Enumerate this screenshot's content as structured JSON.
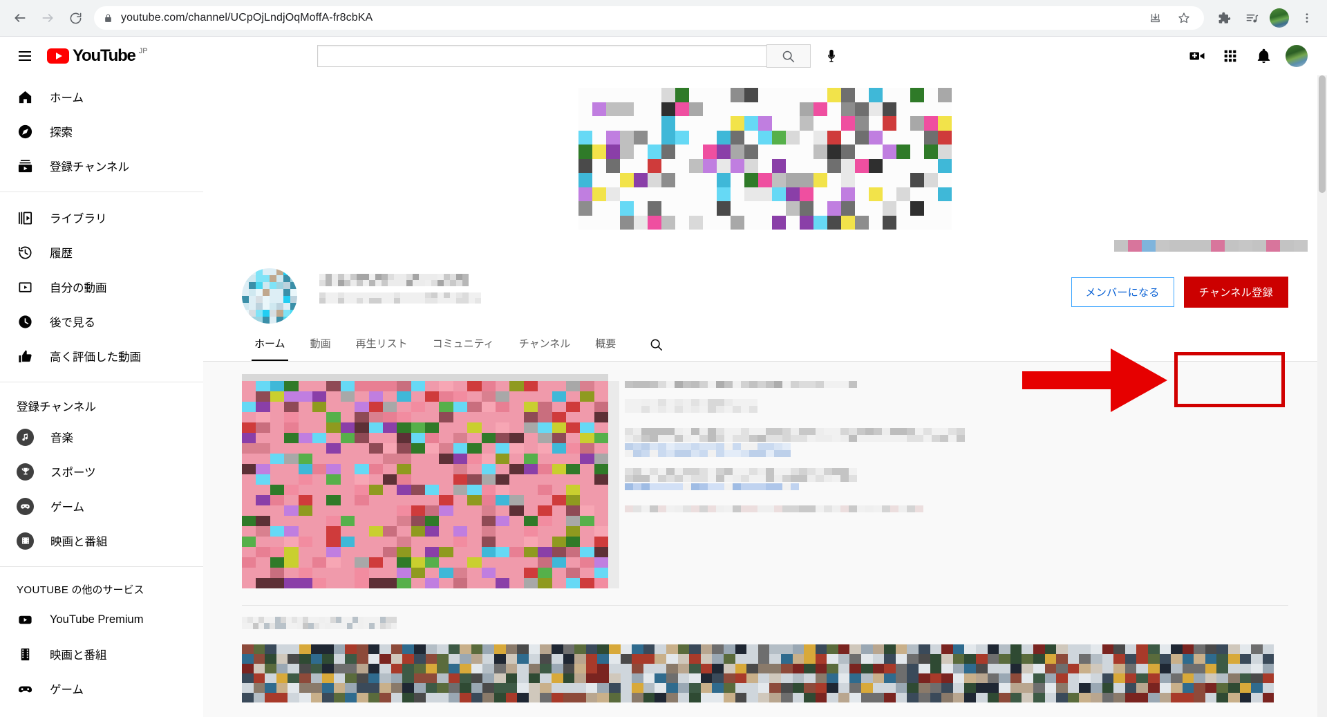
{
  "browser": {
    "back_icon": "back-arrow-icon",
    "forward_icon": "forward-arrow-icon",
    "reload_icon": "reload-icon",
    "lock_icon": "lock-icon",
    "url": "youtube.com/channel/UCpOjLndjOqMoffA-fr8cbKA",
    "url_domain": "youtube.com",
    "url_path": "/channel/UCpOjLndjOqMoffA-fr8cbKA",
    "install_icon": "install-app-icon",
    "bookmark_icon": "star-icon",
    "extensions_icon": "puzzle-piece-icon",
    "media_icon": "music-queue-icon",
    "profile_icon": "profile-avatar",
    "menu_icon": "three-dot-menu-icon"
  },
  "masthead": {
    "menu_icon": "hamburger-menu-icon",
    "logo_text": "YouTube",
    "logo_country": "JP",
    "search_value": "",
    "search_placeholder": "",
    "search_icon": "search-icon",
    "mic_icon": "microphone-icon",
    "create_icon": "create-video-icon",
    "apps_icon": "apps-grid-icon",
    "notifications_icon": "bell-icon",
    "avatar_icon": "user-avatar"
  },
  "sidebar": {
    "primary": [
      {
        "label": "ホーム",
        "icon": "home-icon"
      },
      {
        "label": "探索",
        "icon": "compass-icon"
      },
      {
        "label": "登録チャンネル",
        "icon": "subscriptions-icon"
      }
    ],
    "library": [
      {
        "label": "ライブラリ",
        "icon": "library-icon"
      },
      {
        "label": "履歴",
        "icon": "history-icon"
      },
      {
        "label": "自分の動画",
        "icon": "your-videos-icon"
      },
      {
        "label": "後で見る",
        "icon": "watch-later-icon"
      },
      {
        "label": "高く評価した動画",
        "icon": "thumbs-up-icon"
      }
    ],
    "subscriptions_heading": "登録チャンネル",
    "subscriptions": [
      {
        "label": "音楽",
        "icon": "music-note-icon"
      },
      {
        "label": "スポーツ",
        "icon": "trophy-icon"
      },
      {
        "label": "ゲーム",
        "icon": "gamepad-icon"
      },
      {
        "label": "映画と番組",
        "icon": "film-strip-icon"
      }
    ],
    "more_heading_caps": "YOUTUBE",
    "more_heading_rest": " の他のサービス",
    "more": [
      {
        "label": "YouTube Premium",
        "icon": "youtube-play-icon"
      },
      {
        "label": "映画と番組",
        "icon": "film-strip-icon"
      },
      {
        "label": "ゲーム",
        "icon": "gamepad-icon"
      }
    ]
  },
  "channel": {
    "banner_alt": "channel-banner-blurred",
    "avatar_alt": "channel-avatar-blurred",
    "name_alt": "channel-name-blurred",
    "subscribers_alt": "channel-subscriber-count-blurred",
    "social_links_alt": "channel-social-links-blurred",
    "member_button": "メンバーになる",
    "subscribe_button": "チャンネル登録",
    "tabs": [
      {
        "label": "ホーム",
        "active": true
      },
      {
        "label": "動画",
        "active": false
      },
      {
        "label": "再生リスト",
        "active": false
      },
      {
        "label": "コミュニティ",
        "active": false
      },
      {
        "label": "チャンネル",
        "active": false
      },
      {
        "label": "概要",
        "active": false
      }
    ],
    "tab_search_icon": "search-icon"
  },
  "featured": {
    "thumbnail_alt": "featured-video-thumbnail-blurred",
    "title_alt": "featured-video-title-blurred",
    "meta_alt": "featured-video-views-date-blurred",
    "description_alt": "featured-video-description-blurred"
  },
  "shelf": {
    "title_alt": "shelf-title-blurred",
    "items_alt": "video-thumbnails-row-blurred"
  },
  "annotation": {
    "arrow_icon": "red-arrow-pointing-right",
    "highlight_box": "red-highlight-rectangle",
    "color": "#e60000",
    "box_color": "#d10000"
  },
  "colors": {
    "youtube_red": "#ff0000",
    "subscribe_red": "#cc0000",
    "member_blue": "#065fd4",
    "member_border": "#3ea6ff",
    "page_bg": "#f9f9f9",
    "chrome_bg": "#f1f3f4"
  },
  "scrollbar": {
    "alt": "page-scrollbar"
  }
}
